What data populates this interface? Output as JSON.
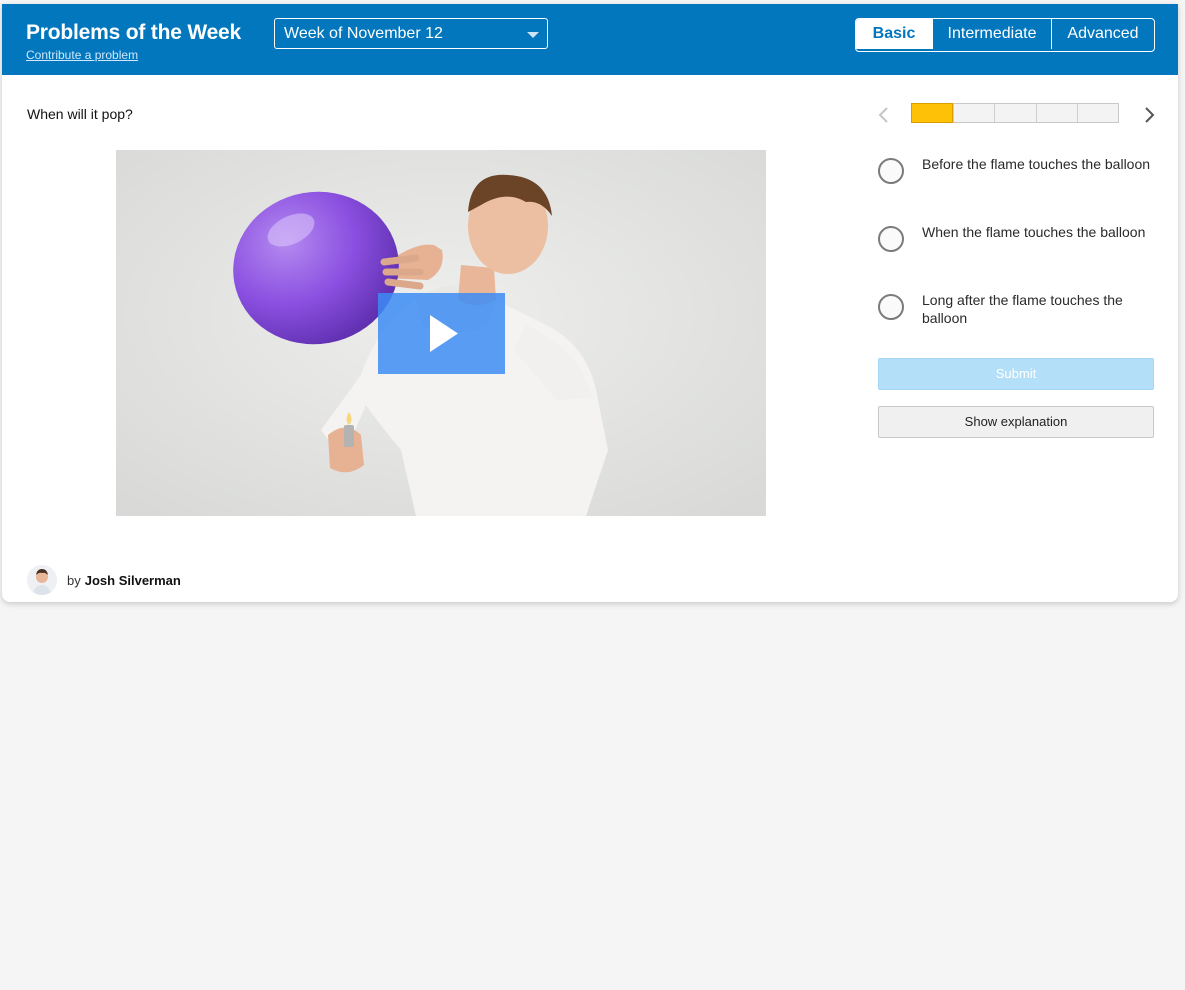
{
  "header": {
    "title": "Problems of the Week",
    "contribute_link": "Contribute a problem",
    "week_select": {
      "selected": "Week of November 12"
    },
    "levels": [
      {
        "label": "Basic",
        "active": true
      },
      {
        "label": "Intermediate",
        "active": false
      },
      {
        "label": "Advanced",
        "active": false
      }
    ]
  },
  "problem": {
    "question": "When will it pop?",
    "media": {
      "icon": "play-icon"
    },
    "progress": {
      "current": 1,
      "total": 5
    },
    "options": [
      "Before the flame touches the balloon",
      "When the flame touches the balloon",
      "Long after the flame touches the balloon"
    ],
    "submit_label": "Submit",
    "explanation_label": "Show explanation"
  },
  "author": {
    "prefix": "by",
    "name": "Josh Silverman"
  },
  "colors": {
    "header_bg": "#0277bd",
    "progress_fill": "#ffc107",
    "submit_disabled": "#b3e0f8",
    "play_button": "#3c8cf5",
    "balloon": "#8a4fe0"
  }
}
